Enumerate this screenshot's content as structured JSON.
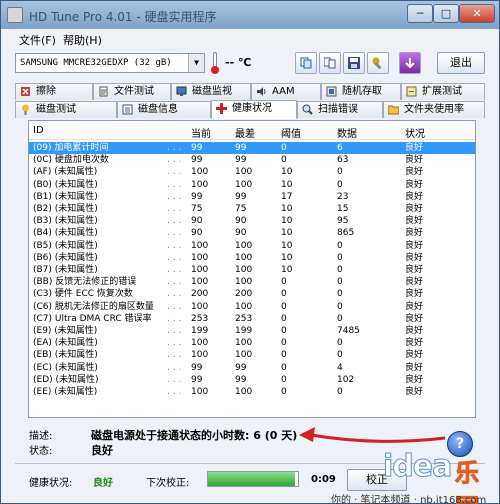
{
  "window": {
    "title": "HD Tune Pro 4.01 - 硬盘实用程序",
    "minimize": "─",
    "maximize": "□",
    "close": "✕"
  },
  "menu": {
    "file": "文件(F)",
    "help": "帮助(H)"
  },
  "toolbar": {
    "drive": "SAMSUNG MMCRE32GEDXP      (32 gB)",
    "temperature": "-- ℃",
    "exit_label": "退出"
  },
  "tabs_top": [
    "擦除",
    "文件测试",
    "磁盘监视",
    "AAM",
    "随机存取",
    "扩展测试"
  ],
  "tabs_bottom": [
    "磁盘测试",
    "磁盘信息",
    "健康状况",
    "扫描错误",
    "文件夹使用率"
  ],
  "table": {
    "columns": [
      "ID",
      "当前",
      "最差",
      "阈值",
      "数据",
      "状况"
    ],
    "rows": [
      {
        "id": "(09) 加电累计时间",
        "cur": "99",
        "worst": "99",
        "thr": "0",
        "data": "6",
        "status": "良好",
        "selected": true
      },
      {
        "id": "(0C) 硬盘加电次数",
        "cur": "99",
        "worst": "99",
        "thr": "0",
        "data": "63",
        "status": "良好"
      },
      {
        "id": "(AF) (未知属性)",
        "cur": "100",
        "worst": "100",
        "thr": "10",
        "data": "0",
        "status": "良好"
      },
      {
        "id": "(B0) (未知属性)",
        "cur": "100",
        "worst": "100",
        "thr": "10",
        "data": "0",
        "status": "良好"
      },
      {
        "id": "(B1) (未知属性)",
        "cur": "99",
        "worst": "99",
        "thr": "17",
        "data": "23",
        "status": "良好"
      },
      {
        "id": "(B2) (未知属性)",
        "cur": "75",
        "worst": "75",
        "thr": "10",
        "data": "15",
        "status": "良好"
      },
      {
        "id": "(B3) (未知属性)",
        "cur": "90",
        "worst": "90",
        "thr": "10",
        "data": "95",
        "status": "良好"
      },
      {
        "id": "(B4) (未知属性)",
        "cur": "90",
        "worst": "90",
        "thr": "10",
        "data": "865",
        "status": "良好"
      },
      {
        "id": "(B5) (未知属性)",
        "cur": "100",
        "worst": "100",
        "thr": "10",
        "data": "0",
        "status": "良好"
      },
      {
        "id": "(B6) (未知属性)",
        "cur": "100",
        "worst": "100",
        "thr": "10",
        "data": "0",
        "status": "良好"
      },
      {
        "id": "(B7) (未知属性)",
        "cur": "100",
        "worst": "100",
        "thr": "10",
        "data": "0",
        "status": "良好"
      },
      {
        "id": "(BB) 反馈无法修正的错误",
        "cur": "100",
        "worst": "100",
        "thr": "0",
        "data": "0",
        "status": "良好"
      },
      {
        "id": "(C3) 硬件 ECC 恢复次数",
        "cur": "200",
        "worst": "200",
        "thr": "0",
        "data": "0",
        "status": "良好"
      },
      {
        "id": "(C6) 脱机无法修正的扇区数量",
        "cur": "100",
        "worst": "100",
        "thr": "0",
        "data": "0",
        "status": "良好"
      },
      {
        "id": "(C7) Ultra DMA CRC 错误率",
        "cur": "253",
        "worst": "253",
        "thr": "0",
        "data": "0",
        "status": "良好"
      },
      {
        "id": "(E9) (未知属性)",
        "cur": "199",
        "worst": "199",
        "thr": "0",
        "data": "7485",
        "status": "良好"
      },
      {
        "id": "(EA) (未知属性)",
        "cur": "100",
        "worst": "100",
        "thr": "0",
        "data": "0",
        "status": "良好"
      },
      {
        "id": "(EB) (未知属性)",
        "cur": "100",
        "worst": "100",
        "thr": "0",
        "data": "0",
        "status": "良好"
      },
      {
        "id": "(EC) (未知属性)",
        "cur": "99",
        "worst": "99",
        "thr": "0",
        "data": "4",
        "status": "良好"
      },
      {
        "id": "(ED) (未知属性)",
        "cur": "99",
        "worst": "99",
        "thr": "0",
        "data": "102",
        "status": "良好"
      },
      {
        "id": "(EE) (未知属性)",
        "cur": "100",
        "worst": "100",
        "thr": "0",
        "data": "0",
        "status": "良好"
      }
    ]
  },
  "details": {
    "desc_label": "描述:",
    "desc_value": "磁盘电源处于接通状态的小时数: 6 (0 天)",
    "status_label": "状态:",
    "status_value": "良好"
  },
  "bottom": {
    "health_label": "健康状况:",
    "health_value": "良好",
    "next_label": "下次校正:",
    "next_time": "0:09",
    "progress_fraction": 0.97,
    "calibrate_label": "校正"
  },
  "watermark": {
    "logo_word": "idea",
    "logo_cn": "乐园",
    "text": "你的 · 笔记本频道 · nb.it168.com"
  },
  "colors": {
    "selected_row": "#3399ff",
    "good": "#1a8a1a",
    "arrow": "#d42020"
  }
}
